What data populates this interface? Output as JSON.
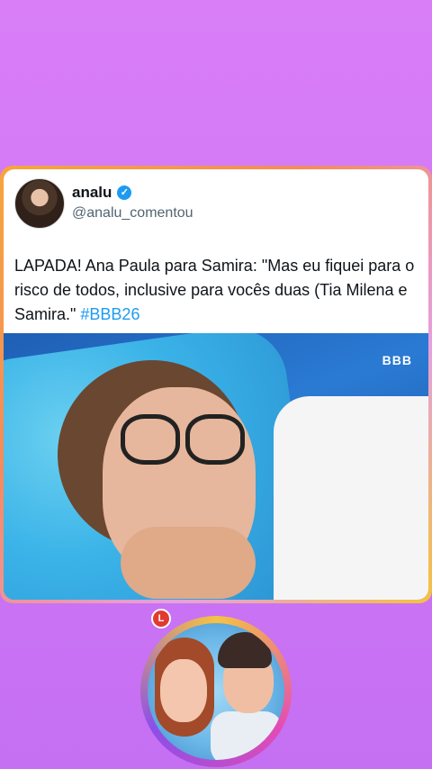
{
  "tweet": {
    "display_name": "analu",
    "handle": "@analu_comentou",
    "text_main": "LAPADA! Ana Paula para Samira: \"Mas eu fiquei para o risco de todos, inclusive para vocês duas (Tia Milena e Samira.\" ",
    "hashtag": "#BBB26",
    "verified_icon": "verified-badge-icon"
  },
  "photo": {
    "broadcast_logo": "BBB"
  },
  "badge": {
    "label": "L"
  },
  "colors": {
    "background": "#d97ef7",
    "hashtag": "#1d9bf0",
    "verified": "#1d9bf0"
  }
}
